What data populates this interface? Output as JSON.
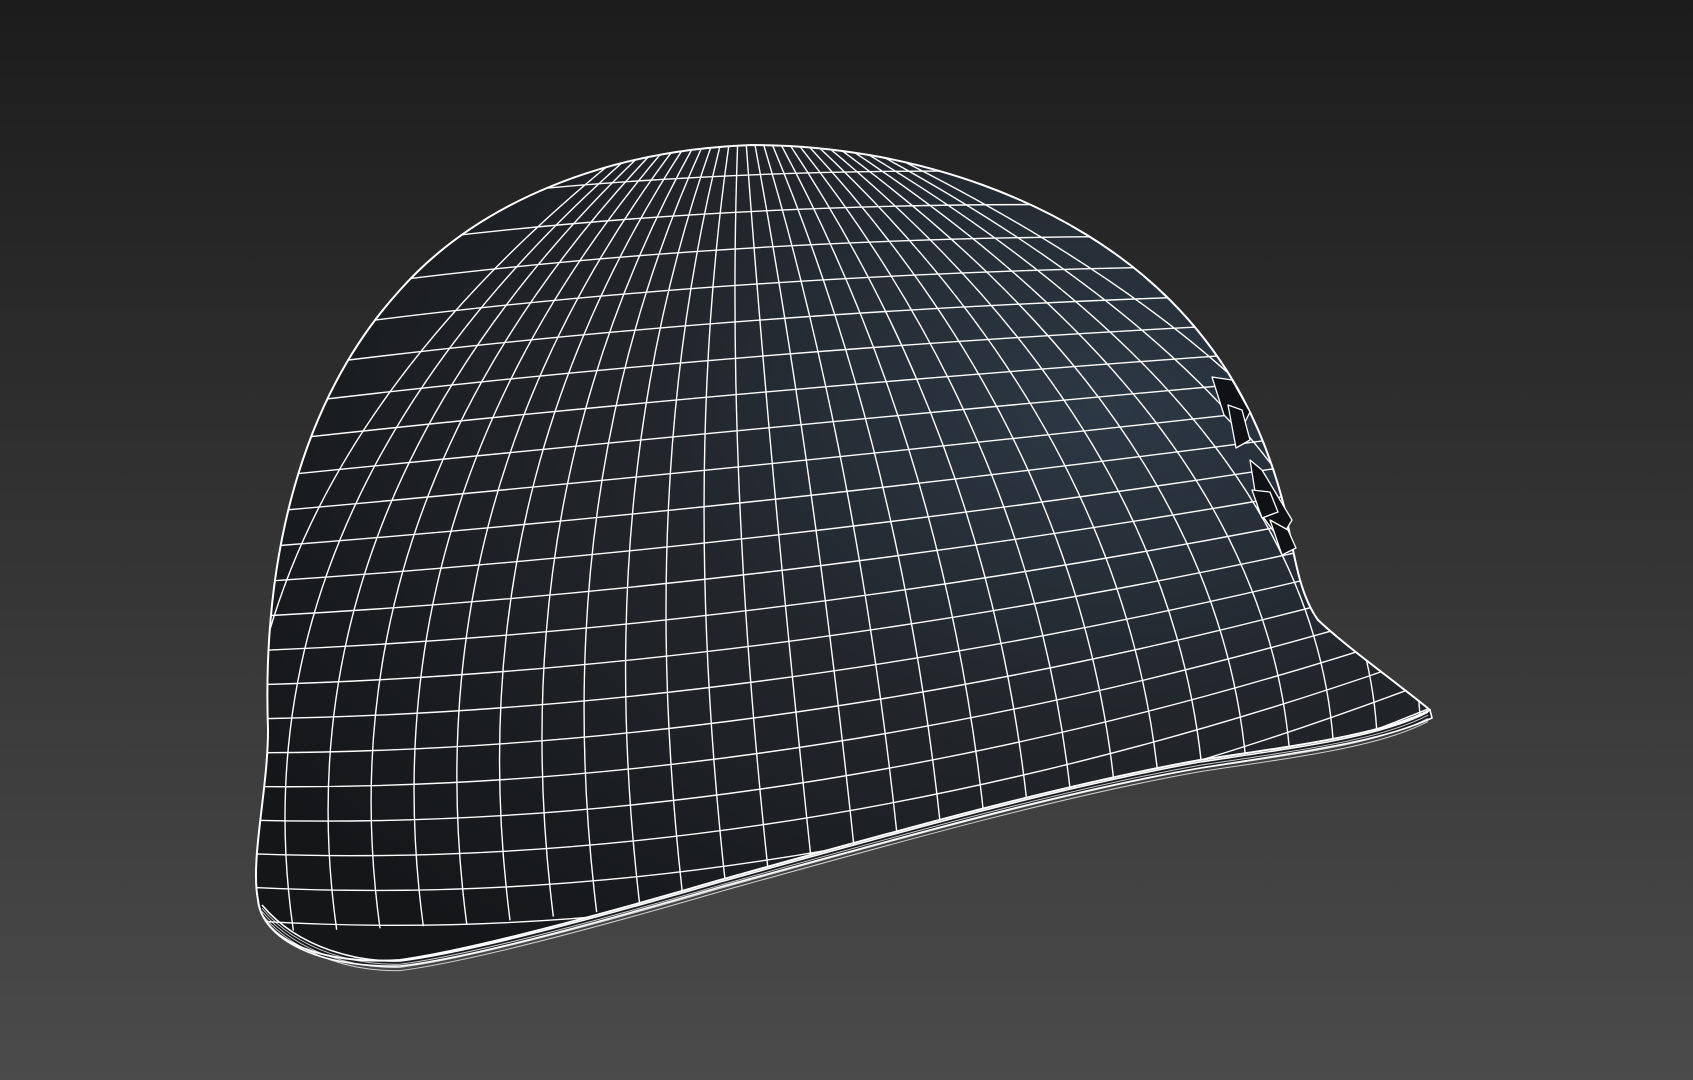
{
  "viewport": {
    "bg_top": "#1c1c1c",
    "bg_bottom": "#4b4b4b"
  },
  "model": {
    "object": "helmet-wireframe",
    "shell_color_dark": "#141618",
    "shell_color_mid": "#22262b",
    "shell_color_highlight": "#2c3845",
    "wire_color": "#ffffff",
    "display_mode": "wireframe-on-shaded"
  }
}
